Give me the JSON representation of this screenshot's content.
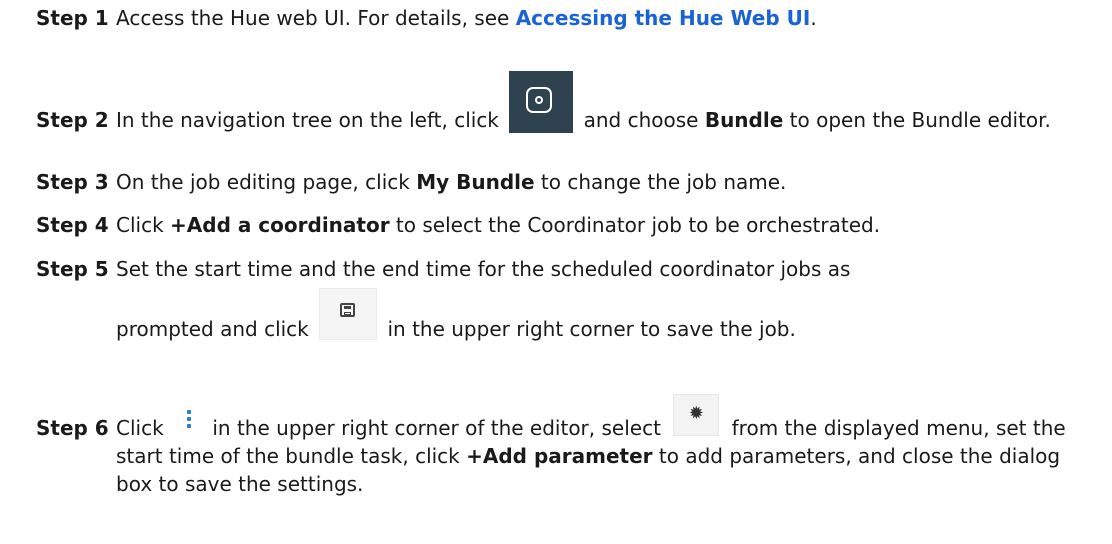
{
  "steps": [
    {
      "num": "Step 1",
      "a": "Access the Hue web UI. For details, see ",
      "link": "Accessing the Hue Web UI",
      "b": "."
    },
    {
      "num": "Step 2",
      "a": "In the navigation tree on the left, click ",
      "b": " and choose ",
      "bold": "Bundle",
      "c": " to open the Bundle editor."
    },
    {
      "num": "Step 3",
      "a": "On the job editing page, click ",
      "bold": "My Bundle",
      "b": " to change the job name."
    },
    {
      "num": "Step 4",
      "a": "Click ",
      "bold": "+Add a coordinator",
      "b": " to select the Coordinator job to be orchestrated."
    },
    {
      "num": "Step 5",
      "a": "Set the start time and the end time for the scheduled coordinator jobs as",
      "b": "prompted and click ",
      "c": " in the upper right corner to save the job."
    },
    {
      "num": "Step 6",
      "a": "Click ",
      "b": " in the upper right corner of the editor, select ",
      "c": " from the displayed menu, set the start time of the bundle task, click ",
      "bold": "+Add parameter",
      "d": " to add parameters, and close the dialog box to save the settings."
    }
  ],
  "icons": {
    "monitor": "⊙",
    "save": "💾",
    "more": "⋮",
    "gear": "✹"
  }
}
